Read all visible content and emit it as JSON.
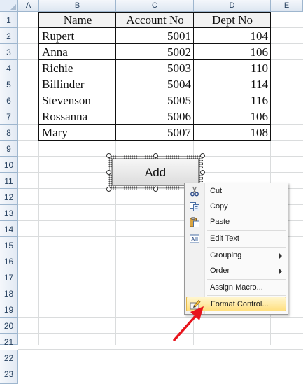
{
  "columns": [
    "A",
    "B",
    "C",
    "D",
    "E"
  ],
  "rows": [
    "1",
    "2",
    "3",
    "4",
    "5",
    "6",
    "7",
    "8",
    "9",
    "10",
    "11",
    "12",
    "13",
    "14",
    "15",
    "16",
    "17",
    "18",
    "19",
    "20",
    "21",
    "22",
    "23"
  ],
  "table": {
    "headers": [
      "Name",
      "Account No",
      "Dept No"
    ],
    "rows": [
      {
        "name": "Rupert",
        "account": "5001",
        "dept": "104"
      },
      {
        "name": "Anna",
        "account": "5002",
        "dept": "106"
      },
      {
        "name": "Richie",
        "account": "5003",
        "dept": "110"
      },
      {
        "name": "Billinder",
        "account": "5004",
        "dept": "114"
      },
      {
        "name": "Stevenson",
        "account": "5005",
        "dept": "116"
      },
      {
        "name": "Rossanna",
        "account": "5006",
        "dept": "106"
      },
      {
        "name": "Mary",
        "account": "5007",
        "dept": "108"
      }
    ]
  },
  "form_button": {
    "label": "Add"
  },
  "context_menu": {
    "items": [
      {
        "label": "Cut",
        "icon": "scissors-icon"
      },
      {
        "label": "Copy",
        "icon": "copy-icon"
      },
      {
        "label": "Paste",
        "icon": "paste-icon"
      },
      {
        "label": "Edit Text",
        "icon": "edit-text-icon"
      },
      {
        "label": "Grouping",
        "submenu": true
      },
      {
        "label": "Order",
        "submenu": true
      },
      {
        "label": "Assign Macro..."
      },
      {
        "label": "Format Control...",
        "icon": "format-control-icon",
        "highlighted": true
      }
    ]
  },
  "colors": {
    "header_fill": "#f2f2f2",
    "grid": "#dadcdd",
    "header_border": "#9eb6ce",
    "highlight": "#ffdf80",
    "arrow": "#e8141c"
  }
}
